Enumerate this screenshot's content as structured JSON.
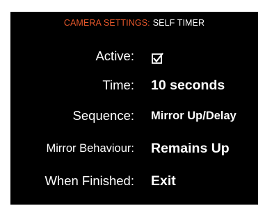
{
  "header": {
    "section": "CAMERA SETTINGS",
    "separator": ":",
    "subsection": "SELF TIMER"
  },
  "settings": {
    "active": {
      "label": "Active:",
      "checked": true,
      "icon": "checkbox-checked-icon"
    },
    "time": {
      "label": "Time:",
      "value": "10 seconds"
    },
    "sequence": {
      "label": "Sequence:",
      "value": "Mirror Up/Delay"
    },
    "mirror": {
      "label": "Mirror Behaviour:",
      "value": "Remains Up"
    },
    "finished": {
      "label": "When Finished:",
      "value": "Exit"
    }
  },
  "colors": {
    "background": "#000000",
    "accent": "#e8582b",
    "text": "#ffffff"
  }
}
